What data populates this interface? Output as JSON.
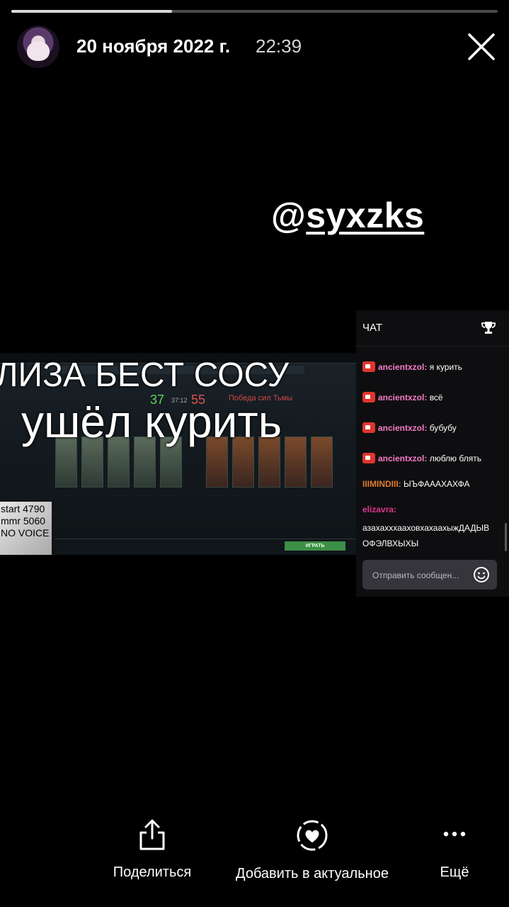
{
  "story": {
    "progress": 0.33,
    "date": "20 ноября 2022 г.",
    "time": "22:39",
    "mention_at": "@",
    "mention_handle": "syxzks"
  },
  "stream": {
    "overlay_line1": "ЛИЗА БЕСТ СОСУ",
    "overlay_line2": "ушёл курить",
    "score_radiant": "37",
    "score_dire": "55",
    "score_time": "37:12",
    "victory_text": "Победа сил Тьмы",
    "play_button": "ИГРАТЬ",
    "webcam_lines": [
      "start 4790",
      "mmr 5060",
      "NO VOICE"
    ]
  },
  "chat": {
    "title": "ЧАТ",
    "messages": [
      {
        "user": "ancientxzol:",
        "text": " я курить",
        "color": "#f77bc8",
        "has_cam": true
      },
      {
        "user": "ancientxzol:",
        "text": " всё",
        "color": "#f77bc8",
        "has_cam": true
      },
      {
        "user": "ancientxzol:",
        "text": " бубубу",
        "color": "#f77bc8",
        "has_cam": true
      },
      {
        "user": "ancientxzol:",
        "text": " люблю блять",
        "color": "#f77bc8",
        "has_cam": true
      },
      {
        "user": "IIIMINDIII:",
        "text": " ЫЪФАААХАХФА",
        "color": "#e07b2c",
        "has_cam": false
      },
      {
        "user": "elizavra:",
        "text_lines": [
          "азахахххааховхахаахыжДАДЫВ",
          "ОФЭЛВХЫХЫ"
        ],
        "color": "#e0358f",
        "has_cam": false
      }
    ],
    "input_placeholder": "Отправить сообщен..."
  },
  "actions": {
    "share": "Поделиться",
    "highlight": "Добавить в актуальное",
    "more": "Ещё"
  },
  "colors": {
    "background": "#000000",
    "chat_bg": "#0e0e10",
    "username_pink": "#f77bc8",
    "username_orange": "#e07b2c",
    "username_magenta": "#e0358f",
    "cam_red": "#e0352e"
  },
  "icons": [
    "close-icon",
    "trophy-icon",
    "camera-badge-icon",
    "emoji-icon",
    "share-icon",
    "heart-circle-icon",
    "more-dots-icon"
  ]
}
